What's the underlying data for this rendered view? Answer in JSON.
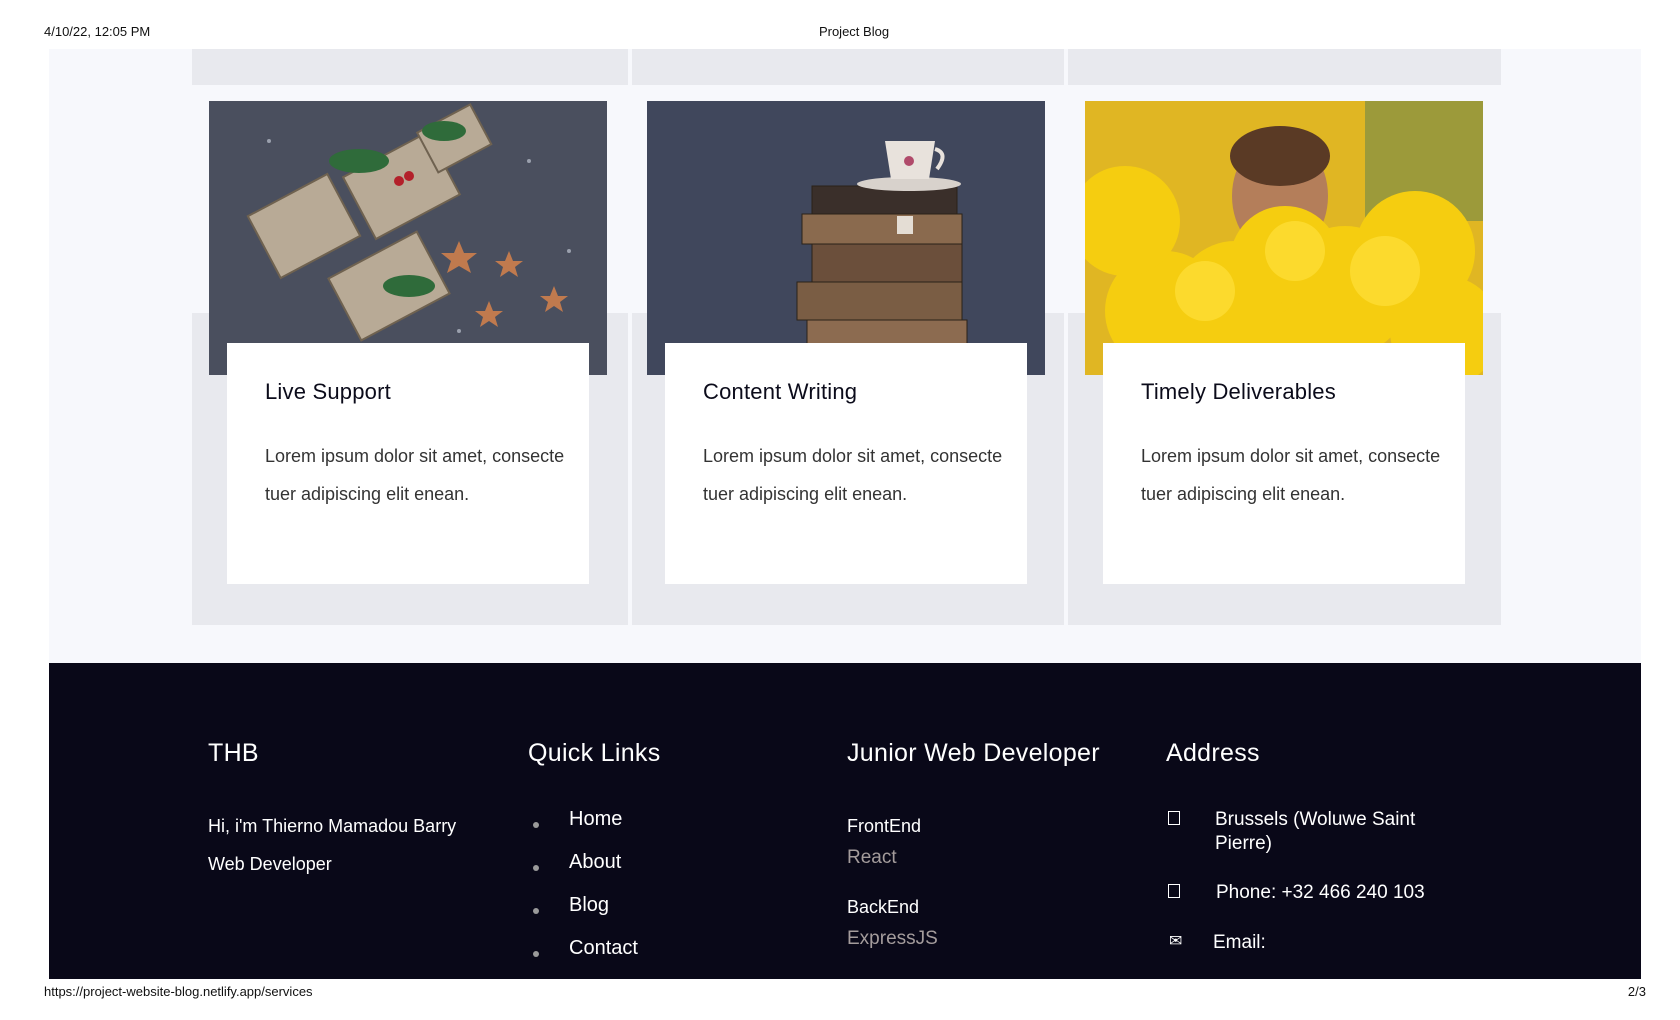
{
  "print": {
    "datetime": "4/10/22, 12:05 PM",
    "title": "Project Blog",
    "url": "https://project-website-blog.netlify.app/services",
    "page": "2/3"
  },
  "services": [
    {
      "title": "Live Support",
      "text": "Lorem ipsum dolor sit amet, consecte tuer adipiscing elit enean.",
      "image": "gift-boxes-photo"
    },
    {
      "title": "Content Writing",
      "text": "Lorem ipsum dolor sit amet, consecte tuer adipiscing elit enean.",
      "image": "books-teacup-photo"
    },
    {
      "title": "Timely Deliverables",
      "text": "Lorem ipsum dolor sit amet, consecte tuer adipiscing elit enean.",
      "image": "yellow-smoke-photo"
    }
  ],
  "footer": {
    "about": {
      "heading": "THB",
      "line1": "Hi, i'm Thierno Mamadou Barry",
      "line2": "Web Developer"
    },
    "quick_links": {
      "heading": "Quick Links",
      "items": [
        "Home",
        "About",
        "Blog",
        "Contact"
      ]
    },
    "dev": {
      "heading": "Junior Web Developer",
      "frontend_label": "FrontEnd",
      "frontend_value": "React",
      "backend_label": "BackEnd",
      "backend_value": "ExpressJS"
    },
    "address": {
      "heading": "Address",
      "location": "Brussels (Woluwe Saint Pierre)",
      "phone": "Phone: +32 466 240 103",
      "email": "Email:"
    }
  },
  "colors": {
    "footer_bg": "#090818",
    "content_bg": "#f7f8fc",
    "column_bg": "#e8e9ee",
    "muted_text": "#a49c9c"
  }
}
